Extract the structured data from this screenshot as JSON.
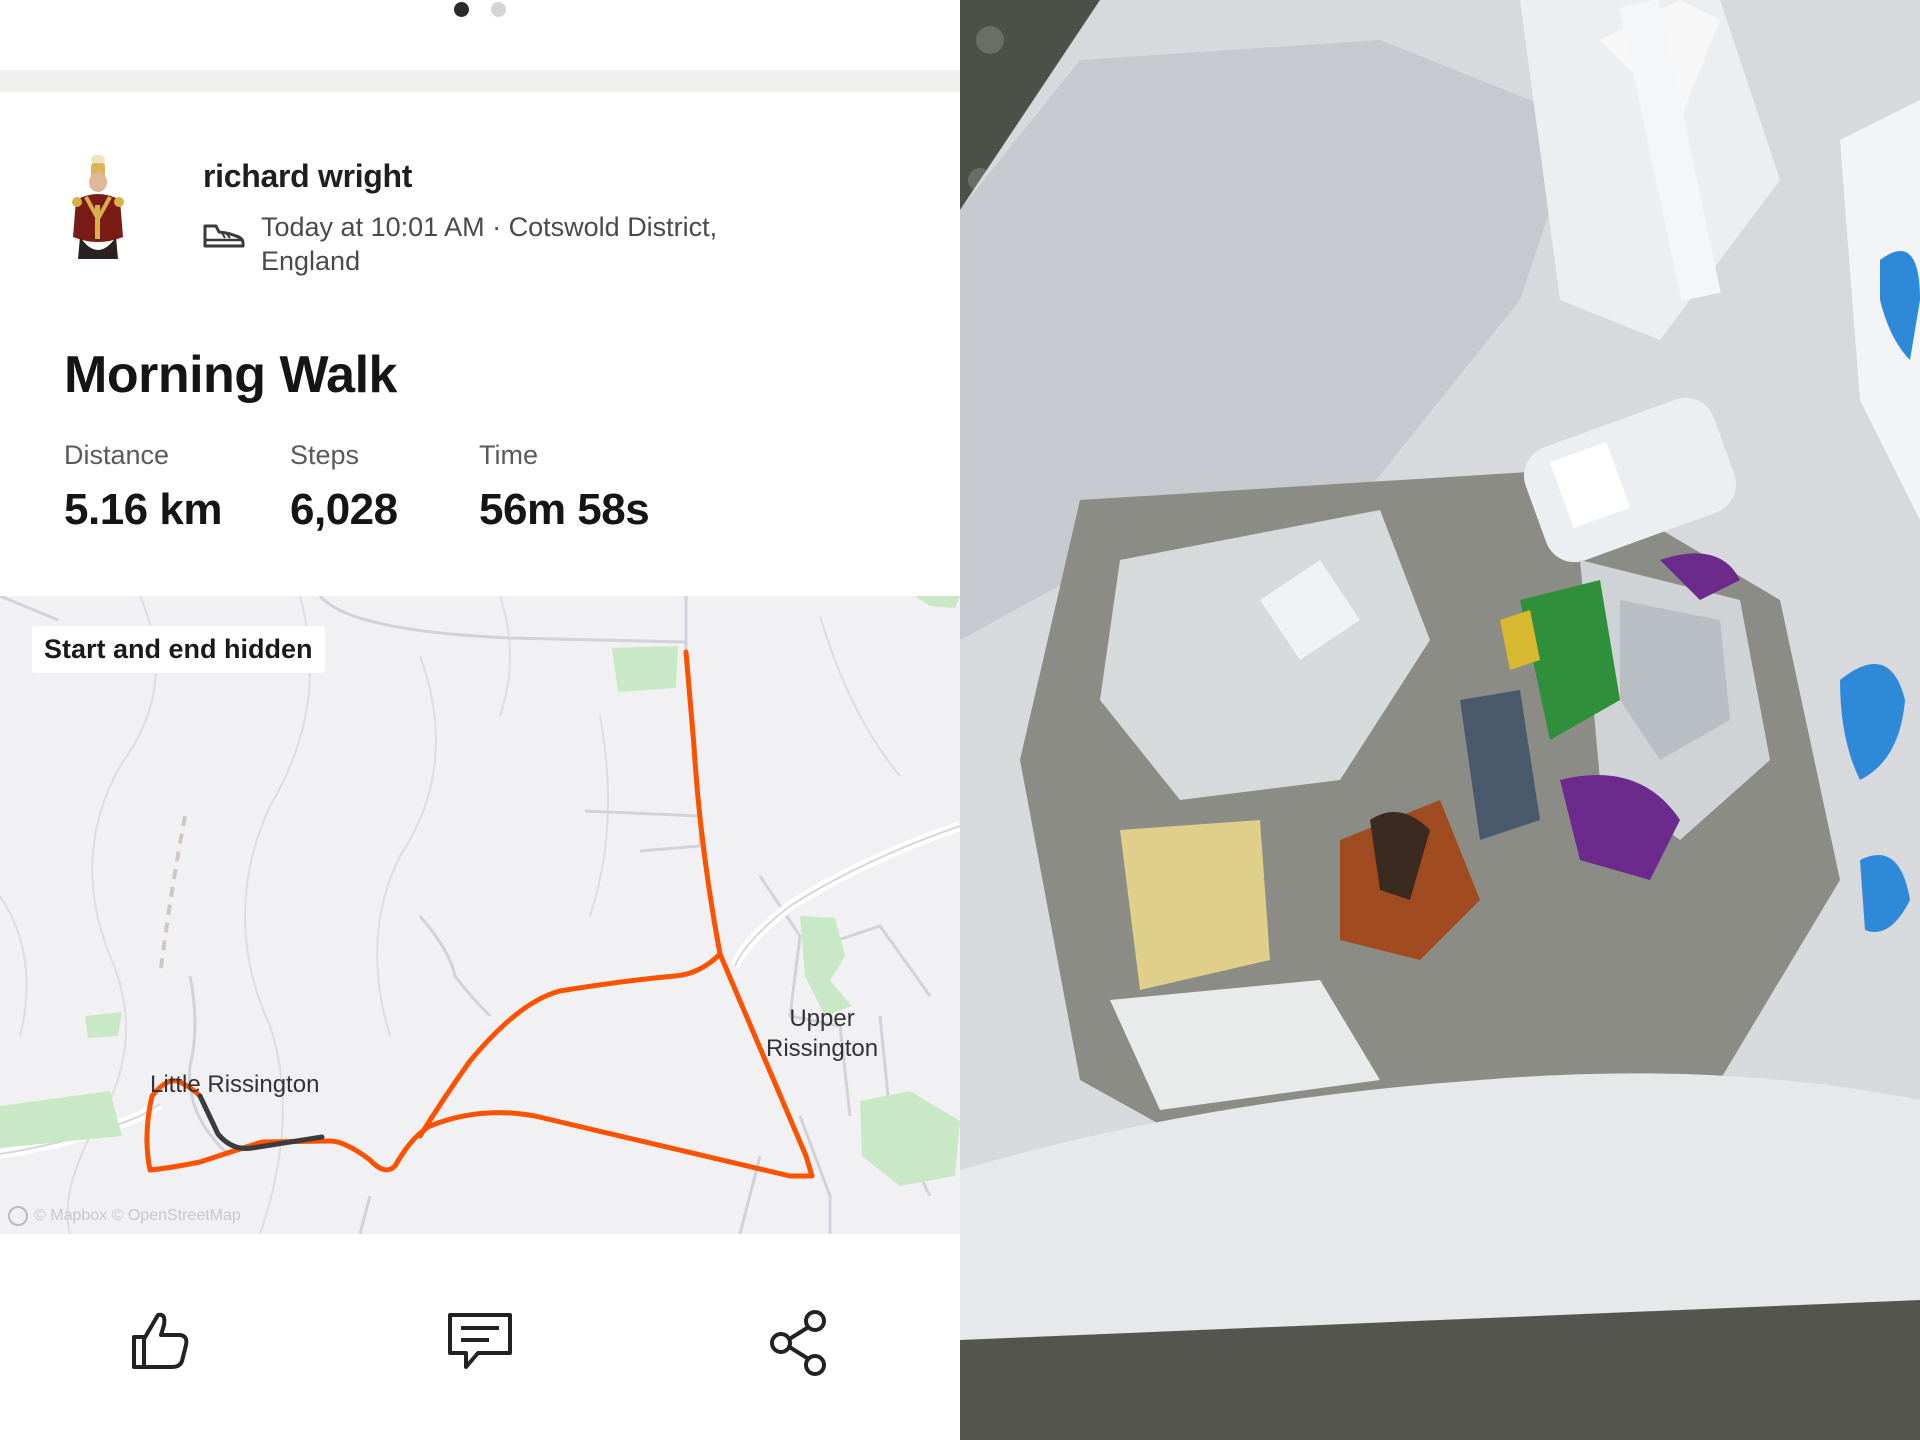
{
  "carousel": {
    "page_count": 2,
    "active_page": 1
  },
  "activity": {
    "athlete_name": "richard wright",
    "meta": "Today at 10:01 AM · Cotswold District, England",
    "title": "Morning Walk",
    "stats": [
      {
        "label": "Distance",
        "value": "5.16 km"
      },
      {
        "label": "Steps",
        "value": "6,028"
      },
      {
        "label": "Time",
        "value": "56m 58s"
      }
    ]
  },
  "map": {
    "privacy_badge": "Start and end hidden",
    "places": {
      "little": "Little Rissington",
      "upper_line1": "Upper",
      "upper_line2": "Rissington"
    },
    "attribution": "© Mapbox © OpenStreetMap",
    "route_color": "#fc5200",
    "hidden_segment_color": "#3c3c3c"
  },
  "actions": {
    "like": "thumbs-up-icon",
    "comment": "comment-icon",
    "share": "share-icon"
  },
  "photo": {
    "subject": "litter-bag-photo"
  }
}
